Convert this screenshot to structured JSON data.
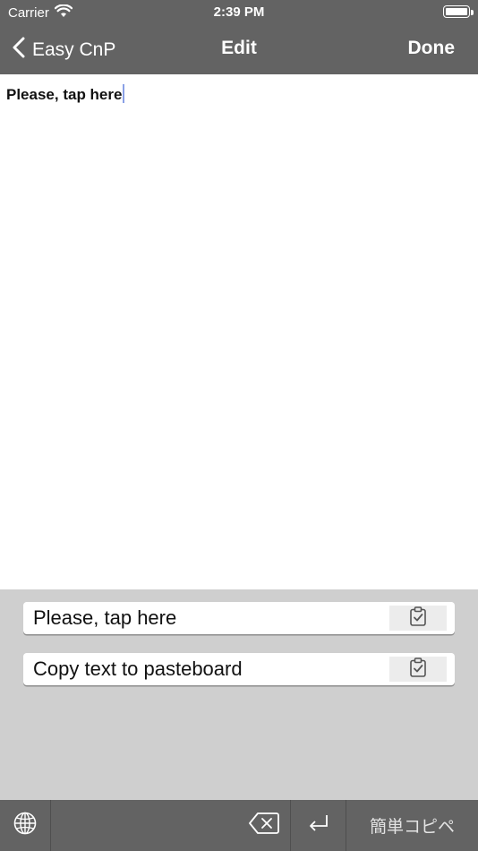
{
  "status_bar": {
    "carrier": "Carrier",
    "time": "2:39 PM"
  },
  "nav": {
    "back_label": "Easy CnP",
    "title": "Edit",
    "done_label": "Done"
  },
  "editor": {
    "text": "Please, tap here"
  },
  "keyboard": {
    "snippets": [
      {
        "text": "Please, tap here",
        "icon": "clipboard-check-icon"
      },
      {
        "text": "Copy text to pasteboard",
        "icon": "clipboard-check-icon"
      }
    ],
    "bottom_bar": {
      "globe_icon": "globe-icon",
      "delete_icon": "backspace-icon",
      "return_icon": "return-icon",
      "keyboard_name": "簡単コピペ"
    }
  },
  "colors": {
    "bar_background": "#636363",
    "keyboard_background": "#cfcfcf",
    "caret": "#8aa0e6"
  }
}
